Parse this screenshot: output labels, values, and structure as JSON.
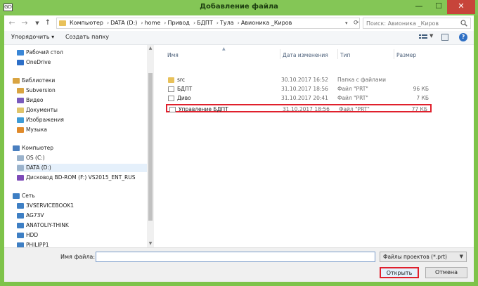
{
  "window": {
    "title": "Добавление файла",
    "app_icon_text": "GD"
  },
  "titlebar": {
    "minimize": "—",
    "maximize": "☐",
    "close": "✕"
  },
  "address": {
    "breadcrumbs": [
      "Компьютер",
      "DATA (D:)",
      "home",
      "Привод",
      "БДПТ",
      "Тула",
      "Авионика _Киров"
    ],
    "separator": "›"
  },
  "search": {
    "placeholder": "Поиск: Авионика _Киров"
  },
  "toolbar": {
    "organize_label": "Упорядочить ▾",
    "new_folder_label": "Создать папку"
  },
  "nav": {
    "items": [
      {
        "label": "Рабочий стол",
        "icon": "desktop-icon",
        "color": "#3a86d6",
        "indent": 1
      },
      {
        "label": "OneDrive",
        "icon": "onedrive-icon",
        "color": "#2d6fc7",
        "indent": 1
      },
      {
        "label": "Библиотеки",
        "icon": "libraries-icon",
        "color": "#d9a441",
        "indent": 0
      },
      {
        "label": "Subversion",
        "icon": "library-icon",
        "color": "#d9a441",
        "indent": 1
      },
      {
        "label": "Видео",
        "icon": "video-icon",
        "color": "#7a5bbd",
        "indent": 1
      },
      {
        "label": "Документы",
        "icon": "documents-icon",
        "color": "#e0c46a",
        "indent": 1
      },
      {
        "label": "Изображения",
        "icon": "pictures-icon",
        "color": "#3e9bd6",
        "indent": 1
      },
      {
        "label": "Музыка",
        "icon": "music-icon",
        "color": "#e08a2a",
        "indent": 1
      },
      {
        "label": "Компьютер",
        "icon": "computer-icon",
        "color": "#4a7fbf",
        "indent": 0
      },
      {
        "label": "OS (C:)",
        "icon": "drive-icon",
        "color": "#9bb3cc",
        "indent": 1
      },
      {
        "label": "DATA (D:)",
        "icon": "drive-icon",
        "color": "#9bb3cc",
        "indent": 1
      },
      {
        "label": "Дисковод BD-ROM (F:) VS2015_ENT_RUS",
        "icon": "visual-studio-icon",
        "color": "#7e4bb8",
        "indent": 1
      },
      {
        "label": "Сеть",
        "icon": "network-icon",
        "color": "#3e7fc4",
        "indent": 0
      },
      {
        "label": "3VSERVICEBOOK1",
        "icon": "computer-icon",
        "color": "#3e7fc4",
        "indent": 1
      },
      {
        "label": "AG73V",
        "icon": "computer-icon",
        "color": "#3e7fc4",
        "indent": 1
      },
      {
        "label": "ANATOLIY-THINK",
        "icon": "computer-icon",
        "color": "#3e7fc4",
        "indent": 1
      },
      {
        "label": "HDD",
        "icon": "computer-icon",
        "color": "#3e7fc4",
        "indent": 1
      },
      {
        "label": "PHILIPP1",
        "icon": "computer-icon",
        "color": "#3e7fc4",
        "indent": 1
      }
    ]
  },
  "files": {
    "columns": {
      "name": "Имя",
      "date": "Дата изменения",
      "type": "Тип",
      "size": "Размер"
    },
    "rows": [
      {
        "name": "src",
        "date": "30.10.2017 16:52",
        "type": "Папка с файлами",
        "size": "",
        "icon": "folder-icon"
      },
      {
        "name": "БДПТ",
        "date": "31.10.2017 18:56",
        "type": "Файл \"PRT\"",
        "size": "96 КБ",
        "icon": "file-icon"
      },
      {
        "name": "Диво",
        "date": "31.10.2017 20:41",
        "type": "Файл \"PRT\"",
        "size": "7 КБ",
        "icon": "file-icon"
      },
      {
        "name": "Управление БДПТ",
        "date": "31.10.2017 18:56",
        "type": "Файл \"PRT\"",
        "size": "77 КБ",
        "icon": "file-icon"
      }
    ]
  },
  "footer": {
    "filename_label": "Имя файла:",
    "filename_value": "",
    "filetype_value": "Файлы проектов (*.prt)",
    "open_label": "Открыть",
    "cancel_label": "Отмена"
  },
  "colors": {
    "titlebar": "#84c656",
    "highlight": "#e0202c",
    "selected_nav": "#e5f0fb"
  }
}
